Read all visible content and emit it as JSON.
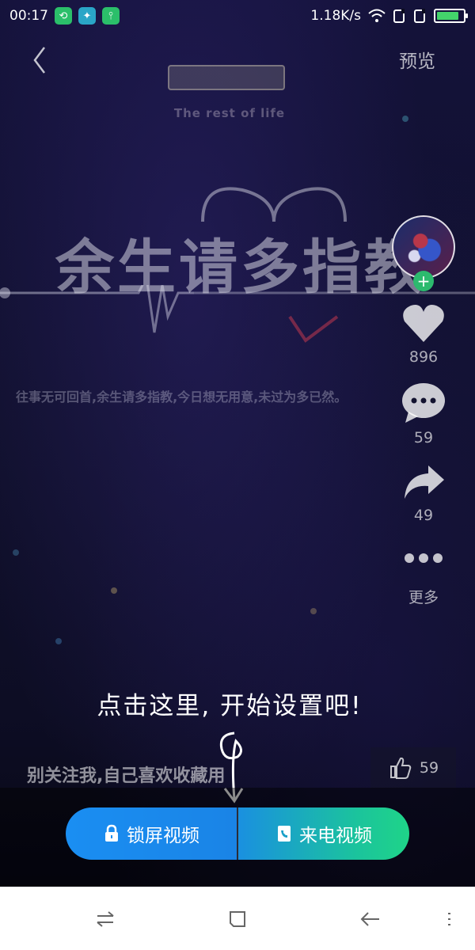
{
  "status_bar": {
    "time": "00:17",
    "network_speed": "1.18K/s",
    "icons": [
      "app-icon-green",
      "app-icon-teal",
      "usb-icon",
      "wifi-icon",
      "signal-icon-1",
      "signal-icon-2",
      "battery-icon"
    ],
    "colors": {
      "app1": "#2bbf6a",
      "app2": "#2aa6c7",
      "app3": "#2bbf6a",
      "battery": "#43d36b"
    }
  },
  "top_bar": {
    "back_icon": "chevron-left-icon",
    "preview_label": "预览"
  },
  "artwork": {
    "subtitle": "The rest of life",
    "title": "余生请多指教",
    "caption": "往事无可回首,余生请多指教,今日想无用意,未过为多已然。"
  },
  "side_actions": {
    "follow_icon": "plus-icon",
    "like_count": "896",
    "comment_count": "59",
    "share_count": "49",
    "more_label": "更多"
  },
  "hint": {
    "text": "点击这里, 开始设置吧!"
  },
  "description": "别关注我,自己喜欢收藏用",
  "like_pill": {
    "count": "59"
  },
  "actions": {
    "lock_screen_label": "锁屏视频",
    "incoming_call_label": "来电视频",
    "colors": {
      "left": "#1a8ef2",
      "right": "#1fd488"
    }
  },
  "nav_bar": {
    "icons": [
      "switch-icon",
      "square-icon",
      "back-arrow-icon",
      "menu-icon"
    ]
  }
}
